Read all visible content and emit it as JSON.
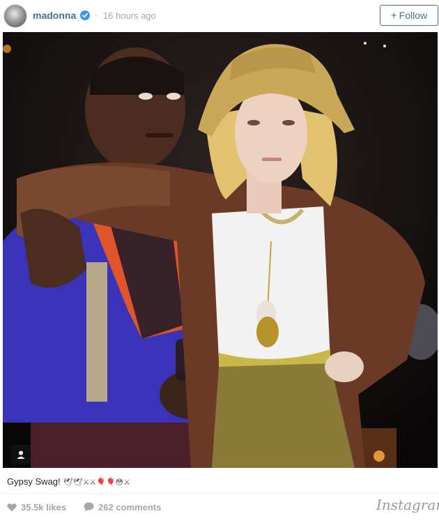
{
  "header": {
    "username": "madonna",
    "separator": "·",
    "time": "16 hours ago",
    "follow_label": "Follow",
    "follow_plus": "+",
    "verified_icon": "verified-badge-icon",
    "accent_color": "#3f729b"
  },
  "photo": {
    "tag_icon": "person-tag-icon"
  },
  "caption": {
    "text": "Gypsy Swag!",
    "emoji": "🕊🕊⚔⚔🎈🎈😳⚔"
  },
  "footer": {
    "likes": "35.5k likes",
    "comments": "262 comments",
    "brand": "Instagram",
    "heart_icon": "heart-icon",
    "comment_icon": "comment-bubble-icon"
  }
}
